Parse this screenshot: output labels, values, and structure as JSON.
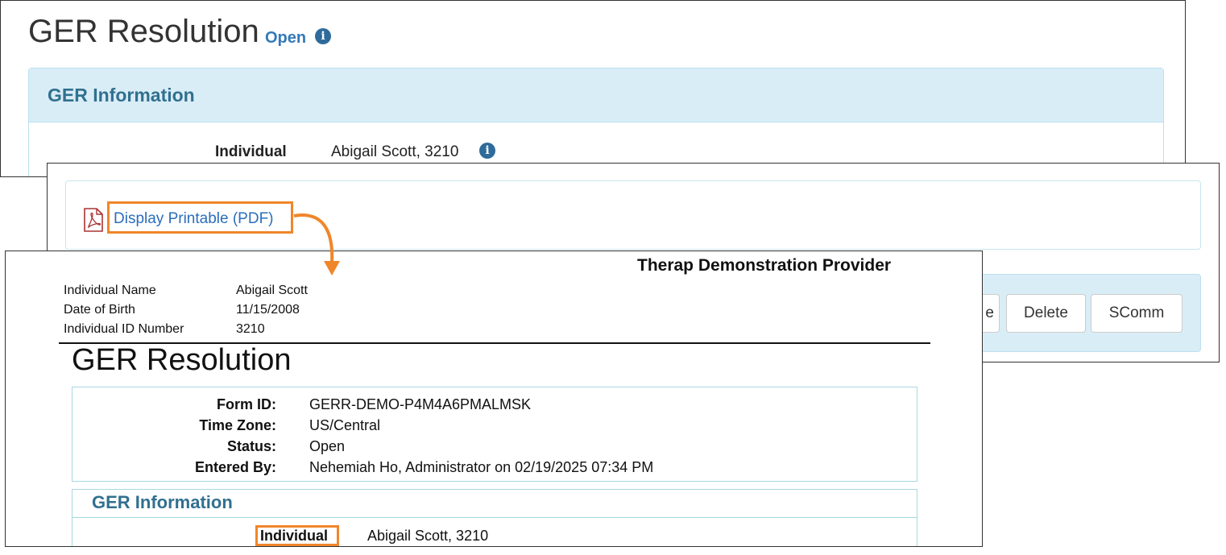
{
  "colors": {
    "accent": "#337ab7",
    "highlight": "#f0862a",
    "panel_header_bg": "#d9edf7",
    "header_text": "#31708f"
  },
  "page": {
    "title": "GER Resolution",
    "status": "Open",
    "section_title": "GER Information",
    "individual_label": "Individual",
    "individual_value": "Abigail Scott, 3210"
  },
  "actions": {
    "pdf_link": "Display Printable (PDF)",
    "partial_button_text": "e",
    "delete_button": "Delete",
    "scomm_button": "SComm"
  },
  "pdf": {
    "provider": "Therap Demonstration Provider",
    "meta": [
      {
        "label": "Individual Name",
        "value": "Abigail Scott"
      },
      {
        "label": "Date of Birth",
        "value": "11/15/2008"
      },
      {
        "label": "Individual ID Number",
        "value": "3210"
      }
    ],
    "title": "GER Resolution",
    "fields": [
      {
        "label": "Form ID:",
        "value": "GERR-DEMO-P4M4A6PMALMSK"
      },
      {
        "label": "Time Zone:",
        "value": "US/Central"
      },
      {
        "label": "Status:",
        "value": "Open"
      },
      {
        "label": "Entered By:",
        "value": "Nehemiah Ho, Administrator on  02/19/2025 07:34 PM"
      }
    ],
    "section_title": "GER Information",
    "individual_label": "Individual",
    "individual_value": "Abigail  Scott, 3210"
  }
}
